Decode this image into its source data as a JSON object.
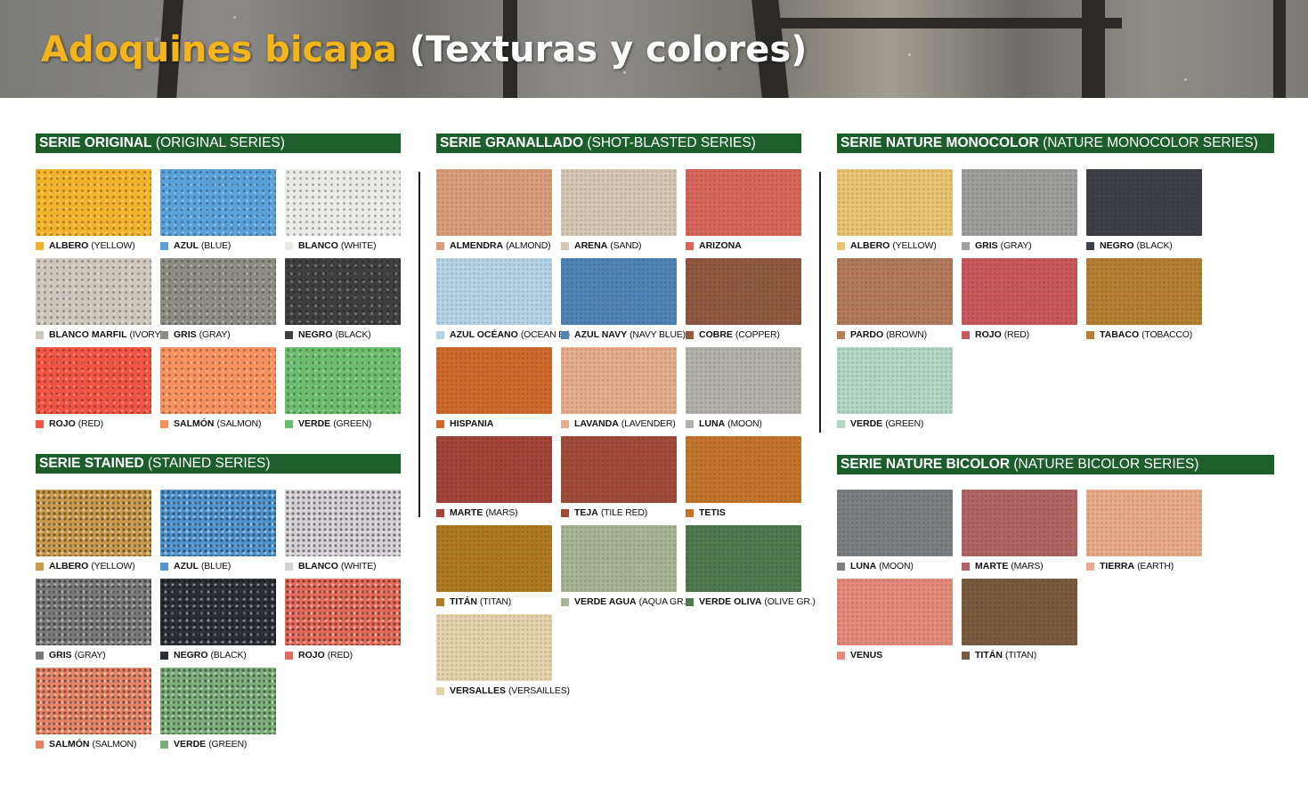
{
  "title": {
    "part1": "Adoquines bicapa",
    "part2": "(Texturas y colores)"
  },
  "sections": {
    "original": {
      "title": "SERIE ORIGINAL",
      "subtitle": "(ORIGINAL SERIES)",
      "items": [
        {
          "name": "ALBERO",
          "en": "(YELLOW)",
          "color": "#f1b22c"
        },
        {
          "name": "AZUL",
          "en": "(BLUE)",
          "color": "#5aa1d9"
        },
        {
          "name": "BLANCO",
          "en": "(WHITE)",
          "color": "#e9e9e6"
        },
        {
          "name": "BLANCO MARFIL",
          "en": "(IVORY)",
          "color": "#cdc6be"
        },
        {
          "name": "GRIS",
          "en": "(GRAY)",
          "color": "#8d8c84"
        },
        {
          "name": "NEGRO",
          "en": "(BLACK)",
          "color": "#3f3f3f"
        },
        {
          "name": "ROJO",
          "en": "(RED)",
          "color": "#ef5542"
        },
        {
          "name": "SALMÓN",
          "en": "(SALMON)",
          "color": "#f6905f"
        },
        {
          "name": "VERDE",
          "en": "(GREEN)",
          "color": "#6bbc6f"
        }
      ]
    },
    "stained": {
      "title": "SERIE STAINED",
      "subtitle": "(STAINED SERIES)",
      "items": [
        {
          "name": "ALBERO",
          "en": "(YELLOW)",
          "color": "#c99a4b"
        },
        {
          "name": "AZUL",
          "en": "(BLUE)",
          "color": "#4f95cf"
        },
        {
          "name": "BLANCO",
          "en": "(WHITE)",
          "color": "#d4d2d4"
        },
        {
          "name": "GRIS",
          "en": "(GRAY)",
          "color": "#7a7a7a"
        },
        {
          "name": "NEGRO",
          "en": "(BLACK)",
          "color": "#2b3036"
        },
        {
          "name": "ROJO",
          "en": "(RED)",
          "color": "#e56a5a"
        },
        {
          "name": "SALMÓN",
          "en": "(SALMON)",
          "color": "#e48366"
        },
        {
          "name": "VERDE",
          "en": "(GREEN)",
          "color": "#7cae7a"
        }
      ]
    },
    "granallado": {
      "title": "SERIE GRANALLADO",
      "subtitle": "(SHOT-BLASTED SERIES)",
      "items": [
        {
          "name": "ALMENDRA",
          "en": "(ALMOND)",
          "color": "#d99d7c"
        },
        {
          "name": "ARENA",
          "en": "(SAND)",
          "color": "#d5c8b3"
        },
        {
          "name": "ARIZONA",
          "en": "",
          "color": "#d8675b"
        },
        {
          "name": "AZUL OCÉANO",
          "en": "(OCEAN B.)",
          "color": "#b6d2e6"
        },
        {
          "name": "AZUL NAVY",
          "en": "(NAVY BLUE)",
          "color": "#4f84b4"
        },
        {
          "name": "COBRE",
          "en": "(COPPER)",
          "color": "#915942"
        },
        {
          "name": "HISPANIA",
          "en": "",
          "color": "#cf6a2a"
        },
        {
          "name": "LAVANDA",
          "en": "(LAVENDER)",
          "color": "#e5ad8f"
        },
        {
          "name": "LUNA",
          "en": "(MOON)",
          "color": "#b4b2aa"
        },
        {
          "name": "MARTE",
          "en": "(MARS)",
          "color": "#a4443a"
        },
        {
          "name": "TEJA",
          "en": "(TILE RED)",
          "color": "#a14c3a"
        },
        {
          "name": "TETIS",
          "en": "",
          "color": "#c3752c"
        },
        {
          "name": "TITÁN",
          "en": "(TITAN)",
          "color": "#b07a22"
        },
        {
          "name": "VERDE AGUA",
          "en": "(AQUA GR.)",
          "color": "#a8b595"
        },
        {
          "name": "VERDE OLIVA",
          "en": "(OLIVE GR.)",
          "color": "#4e7a4d"
        },
        {
          "name": "VERSALLES",
          "en": "(VERSAILLES)",
          "color": "#e4d3ab"
        }
      ]
    },
    "monocolor": {
      "title": "SERIE NATURE MONOCOLOR",
      "subtitle": "(NATURE MONOCOLOR SERIES)",
      "items": [
        {
          "name": "ALBERO",
          "en": "(YELLOW)",
          "color": "#e8c473"
        },
        {
          "name": "GRIS",
          "en": "(GRAY)",
          "color": "#9fa09e"
        },
        {
          "name": "NEGRO",
          "en": "(BLACK)",
          "color": "#3f4047"
        },
        {
          "name": "PARDO",
          "en": "(BROWN)",
          "color": "#b47a5d"
        },
        {
          "name": "ROJO",
          "en": "(RED)",
          "color": "#c9585a"
        },
        {
          "name": "TABACO",
          "en": "(TOBACCO)",
          "color": "#b57f34"
        },
        {
          "name": "VERDE",
          "en": "(GREEN)",
          "color": "#b4d6c4"
        }
      ]
    },
    "bicolor": {
      "title": "SERIE NATURE BICOLOR",
      "subtitle": "(NATURE BICOLOR SERIES)",
      "items": [
        {
          "name": "LUNA",
          "en": "(MOON)",
          "color": "#7d7f80"
        },
        {
          "name": "MARTE",
          "en": "(MARS)",
          "color": "#b06563"
        },
        {
          "name": "TIERRA",
          "en": "(EARTH)",
          "color": "#e9ab8b"
        },
        {
          "name": "VENUS",
          "en": "",
          "color": "#e38c7b"
        },
        {
          "name": "TITÁN",
          "en": "(TITAN)",
          "color": "#7a5b3e"
        }
      ]
    }
  }
}
